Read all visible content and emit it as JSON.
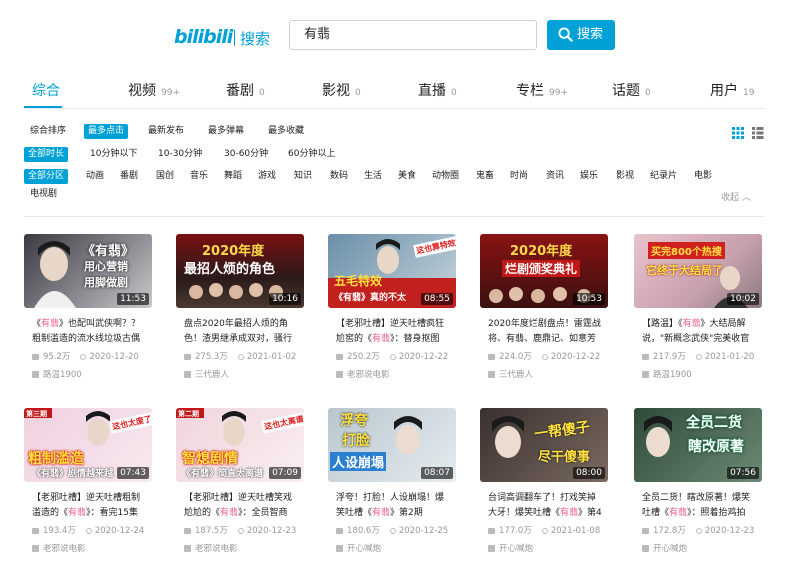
{
  "header": {
    "logo_text": "bilibili",
    "logo_sub": "搜索",
    "search_value": "有翡",
    "search_button": "搜索"
  },
  "tabs": [
    {
      "label": "综合",
      "count": ""
    },
    {
      "label": "视频",
      "count": "99+"
    },
    {
      "label": "番剧",
      "count": "0"
    },
    {
      "label": "影视",
      "count": "0"
    },
    {
      "label": "直播",
      "count": "0"
    },
    {
      "label": "专栏",
      "count": "99+"
    },
    {
      "label": "话题",
      "count": "0"
    },
    {
      "label": "用户",
      "count": "19"
    }
  ],
  "sort_options": [
    "综合排序",
    "最多点击",
    "最新发布",
    "最多弹幕",
    "最多收藏"
  ],
  "duration_options": [
    "全部时长",
    "10分钟以下",
    "10-30分钟",
    "30-60分钟",
    "60分钟以上"
  ],
  "zone_options": [
    "全部分区",
    "动画",
    "番剧",
    "国创",
    "音乐",
    "舞蹈",
    "游戏",
    "知识",
    "数码",
    "生活",
    "美食",
    "动物圈",
    "鬼畜",
    "时尚",
    "资讯",
    "娱乐",
    "影视",
    "纪录片",
    "电影",
    "电视剧"
  ],
  "collapse_label": "收起",
  "videos": [
    {
      "pre": "《",
      "hl": "有翡",
      "post": "》也配叫武侠啊？？粗制滥造的流水线垃圾古偶",
      "views": "95.2万",
      "date": "2020-12-20",
      "uploader": "路温1900",
      "duration": "11:53",
      "caption1": "《有翡》",
      "caption2": "用心营销",
      "caption3": "用脚做剧"
    },
    {
      "pre": "",
      "hl": "",
      "post": "盘点2020年最招人烦的角色！渣男继承成双对，骚行",
      "views": "275.3万",
      "date": "2021-01-02",
      "uploader": "三代鹿人",
      "duration": "10:16",
      "caption1": "2020年度",
      "caption2": "最招人烦的角色",
      "caption3": ""
    },
    {
      "pre": "【老邪吐槽】逆天吐槽疯狂尬窖的《",
      "hl": "有翡",
      "post": "》：替身抠图",
      "views": "250.2万",
      "date": "2020-12-22",
      "uploader": "老邪说电影",
      "duration": "08:55",
      "caption1": "五毛特效",
      "caption2": "《有翡》真的不太",
      "caption3": "这也算特效?"
    },
    {
      "pre": "",
      "hl": "",
      "post": "2020年度烂剧盘点！雷霆战将、有翡、鹿鼎记、如意芳",
      "views": "224.0万",
      "date": "2020-12-22",
      "uploader": "三代鹿人",
      "duration": "10:53",
      "caption1": "2020年度",
      "caption2": "烂剧颁奖典礼",
      "caption3": ""
    },
    {
      "pre": "【路温】《",
      "hl": "有翡",
      "post": "》大结局解说，\"新概念武侠\"完美收官",
      "views": "217.9万",
      "date": "2021-01-20",
      "uploader": "路温1900",
      "duration": "10:02",
      "caption1": "买完800个热搜",
      "caption2": "它终于大结局了",
      "caption3": ""
    },
    {
      "pre": "【老邪吐槽】逆天吐槽粗制滥造的《",
      "hl": "有翡",
      "post": "》：看完15集",
      "views": "193.4万",
      "date": "2020-12-24",
      "uploader": "老邪说电影",
      "duration": "07:43",
      "caption1": "粗制滥造",
      "caption2": "《有翡》剧情越来越",
      "caption3": "这也太废了!"
    },
    {
      "pre": "【老邪吐槽】逆天吐槽笑戏尬尬的《",
      "hl": "有翡",
      "post": "》：全员智商",
      "views": "187.5万",
      "date": "2020-12-23",
      "uploader": "老邪说电影",
      "duration": "07:09",
      "caption1": "智熄剧情",
      "caption2": "《有翡》简直太离谱",
      "caption3": "这也太离谱!"
    },
    {
      "pre": "浮夸！打脸！人设崩塌！爆笑吐槽《",
      "hl": "有翡",
      "post": "》第2期",
      "views": "180.6万",
      "date": "2020-12-25",
      "uploader": "开心喊炮",
      "duration": "08:07",
      "caption1": "浮夸",
      "caption2": "打脸",
      "caption3": "人设崩塌"
    },
    {
      "pre": "台词高调翻车了！打戏笑掉大牙！爆笑吐槽《",
      "hl": "有翡",
      "post": "》第4",
      "views": "177.0万",
      "date": "2021-01-08",
      "uploader": "开心喊炮",
      "duration": "08:00",
      "caption1": "一帮傻子",
      "caption2": "尽干傻事",
      "caption3": ""
    },
    {
      "pre": "全员二货！瞎改原著！爆笑吐槽《",
      "hl": "有翡",
      "post": "》：照着抬鸡拍",
      "views": "172.8万",
      "date": "2020-12-23",
      "uploader": "开心喊炮",
      "duration": "07:56",
      "caption1": "全员二货",
      "caption2": "瞎改原著",
      "caption3": ""
    }
  ],
  "colors": {
    "accent": "#00a1d6",
    "highlight": "#f25d8e"
  }
}
